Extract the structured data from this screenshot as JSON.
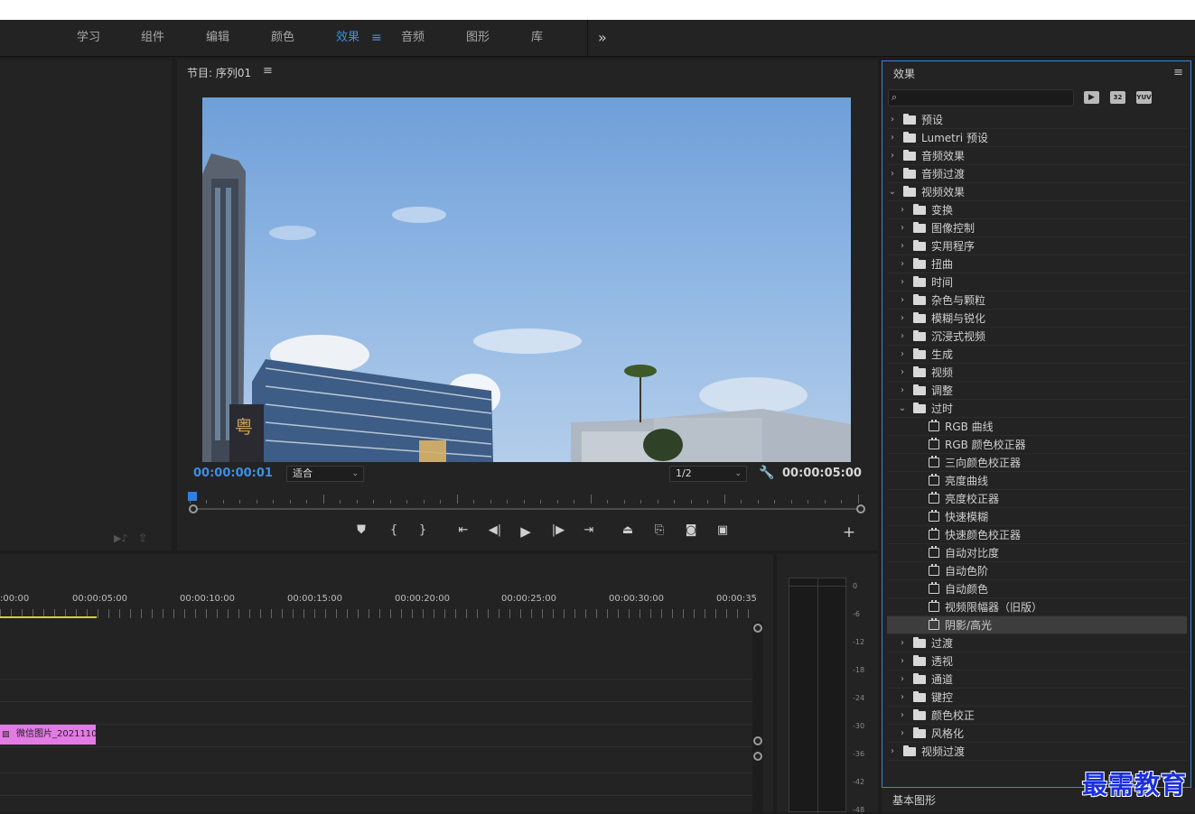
{
  "menu": {
    "tabs": [
      "学习",
      "组件",
      "编辑",
      "颜色",
      "效果",
      "音频",
      "图形",
      "库"
    ],
    "active_tab": "效果",
    "more_icon": "double-chevron-right-icon"
  },
  "program": {
    "title": "节目: 序列01",
    "current_time": "00:00:00:01",
    "fit": "适合",
    "resolution": "1/2",
    "duration": "00:00:05:00"
  },
  "timeline": {
    "time_labels": [
      ":00:00",
      "00:00:05:00",
      "00:00:10:00",
      "00:00:15:00",
      "00:00:20:00",
      "00:00:25:00",
      "00:00:30:00",
      "00:00:35"
    ],
    "clip_label": "微信图片_2021110"
  },
  "meter": {
    "db_labels": [
      "0",
      "-6",
      "-12",
      "-18",
      "-24",
      "-30",
      "-36",
      "-42",
      "-48"
    ]
  },
  "effects": {
    "title": "效果",
    "badges": [
      "32",
      "YUV"
    ],
    "items": [
      {
        "label": "预设",
        "level": 0,
        "type": "preset",
        "state": "collapsed"
      },
      {
        "label": "Lumetri 预设",
        "level": 0,
        "type": "preset",
        "state": "collapsed"
      },
      {
        "label": "音频效果",
        "level": 0,
        "type": "folder",
        "state": "collapsed"
      },
      {
        "label": "音频过渡",
        "level": 0,
        "type": "folder",
        "state": "collapsed"
      },
      {
        "label": "视频效果",
        "level": 0,
        "type": "folder",
        "state": "expanded"
      },
      {
        "label": "变换",
        "level": 1,
        "type": "folder",
        "state": "collapsed"
      },
      {
        "label": "图像控制",
        "level": 1,
        "type": "folder",
        "state": "collapsed"
      },
      {
        "label": "实用程序",
        "level": 1,
        "type": "folder",
        "state": "collapsed"
      },
      {
        "label": "扭曲",
        "level": 1,
        "type": "folder",
        "state": "collapsed"
      },
      {
        "label": "时间",
        "level": 1,
        "type": "folder",
        "state": "collapsed"
      },
      {
        "label": "杂色与颗粒",
        "level": 1,
        "type": "folder",
        "state": "collapsed"
      },
      {
        "label": "模糊与锐化",
        "level": 1,
        "type": "folder",
        "state": "collapsed"
      },
      {
        "label": "沉浸式视频",
        "level": 1,
        "type": "folder",
        "state": "collapsed"
      },
      {
        "label": "生成",
        "level": 1,
        "type": "folder",
        "state": "collapsed"
      },
      {
        "label": "视频",
        "level": 1,
        "type": "folder",
        "state": "collapsed"
      },
      {
        "label": "调整",
        "level": 1,
        "type": "folder",
        "state": "collapsed"
      },
      {
        "label": "过时",
        "level": 1,
        "type": "folder",
        "state": "expanded"
      },
      {
        "label": "RGB 曲线",
        "level": 2,
        "type": "effect"
      },
      {
        "label": "RGB 颜色校正器",
        "level": 2,
        "type": "effect"
      },
      {
        "label": "三向颜色校正器",
        "level": 2,
        "type": "effect"
      },
      {
        "label": "亮度曲线",
        "level": 2,
        "type": "effect"
      },
      {
        "label": "亮度校正器",
        "level": 2,
        "type": "effect"
      },
      {
        "label": "快速模糊",
        "level": 2,
        "type": "effect"
      },
      {
        "label": "快速颜色校正器",
        "level": 2,
        "type": "effect"
      },
      {
        "label": "自动对比度",
        "level": 2,
        "type": "effect"
      },
      {
        "label": "自动色阶",
        "level": 2,
        "type": "effect"
      },
      {
        "label": "自动颜色",
        "level": 2,
        "type": "effect"
      },
      {
        "label": "视频限幅器（旧版）",
        "level": 2,
        "type": "effect"
      },
      {
        "label": "阴影/高光",
        "level": 2,
        "type": "effect",
        "selected": true
      },
      {
        "label": "过渡",
        "level": 1,
        "type": "folder",
        "state": "collapsed"
      },
      {
        "label": "透视",
        "level": 1,
        "type": "folder",
        "state": "collapsed"
      },
      {
        "label": "通道",
        "level": 1,
        "type": "folder",
        "state": "collapsed"
      },
      {
        "label": "键控",
        "level": 1,
        "type": "folder",
        "state": "collapsed"
      },
      {
        "label": "颜色校正",
        "level": 1,
        "type": "folder",
        "state": "collapsed"
      },
      {
        "label": "风格化",
        "level": 1,
        "type": "folder",
        "state": "collapsed"
      },
      {
        "label": "视频过渡",
        "level": 0,
        "type": "folder",
        "state": "collapsed"
      }
    ]
  },
  "basic_graphics": {
    "title": "基本图形"
  },
  "watermark": "最需教育",
  "colors": {
    "accent": "#3b8fe6",
    "clip": "#e37be4",
    "panel_border": "#3f83d6",
    "watermark": "#1a2ed8"
  }
}
